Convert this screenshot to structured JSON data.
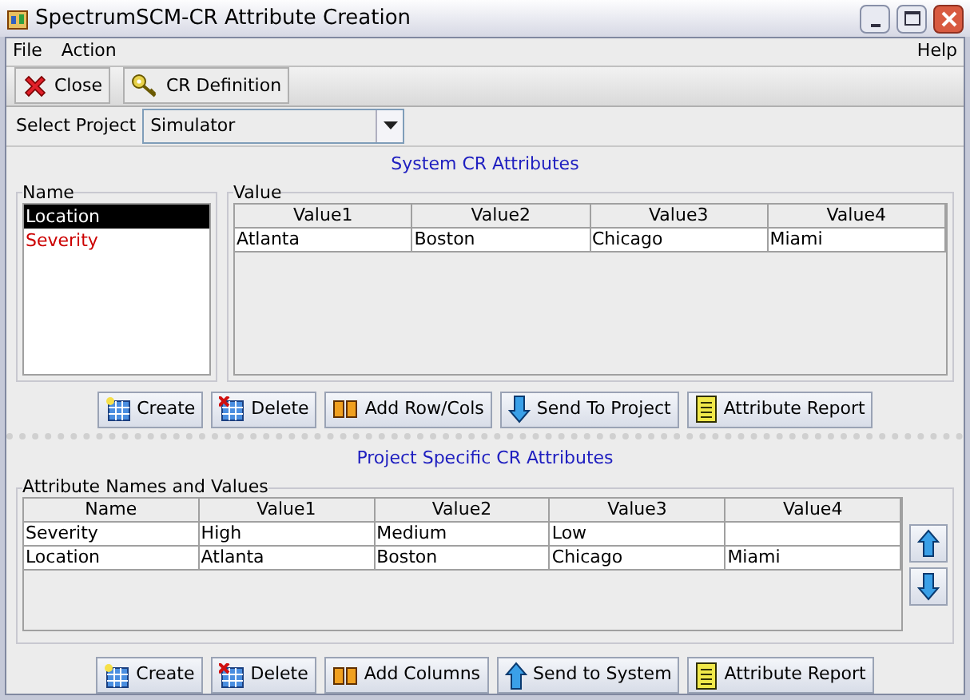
{
  "window": {
    "title": "SpectrumSCM-CR Attribute Creation"
  },
  "menu": {
    "left": [
      "File",
      "Action"
    ],
    "right": [
      "Help"
    ]
  },
  "toolbar": [
    {
      "label": "Close",
      "kind": "close"
    },
    {
      "label": "CR Definition",
      "kind": "key"
    }
  ],
  "project_select": {
    "label": "Select Project",
    "value": "Simulator"
  },
  "system_section": {
    "title": "System CR Attributes",
    "name_group": {
      "title": "Name",
      "items": [
        {
          "label": "Location",
          "selected": true
        },
        {
          "label": "Severity",
          "selected": false,
          "color": "#cc0000"
        }
      ]
    },
    "value_group": {
      "title": "Value",
      "columns": [
        "Value1",
        "Value2",
        "Value3",
        "Value4"
      ],
      "rows": [
        [
          "Atlanta",
          "Boston",
          "Chicago",
          "Miami"
        ]
      ]
    },
    "buttons": [
      {
        "label": "Create",
        "kind": "create"
      },
      {
        "label": "Delete",
        "kind": "delete"
      },
      {
        "label": "Add Row/Cols",
        "kind": "add"
      },
      {
        "label": "Send To Project",
        "kind": "down"
      },
      {
        "label": "Attribute Report",
        "kind": "report"
      }
    ]
  },
  "project_section": {
    "title": "Project Specific CR Attributes",
    "group_title": "Attribute Names and Values",
    "columns": [
      "Name",
      "Value1",
      "Value2",
      "Value3",
      "Value4"
    ],
    "rows": [
      [
        "Severity",
        "High",
        "Medium",
        "Low",
        ""
      ],
      [
        "Location",
        "Atlanta",
        "Boston",
        "Chicago",
        "Miami"
      ]
    ],
    "buttons": [
      {
        "label": "Create",
        "kind": "create"
      },
      {
        "label": "Delete",
        "kind": "delete"
      },
      {
        "label": "Add Columns",
        "kind": "add"
      },
      {
        "label": "Send to System",
        "kind": "up"
      },
      {
        "label": "Attribute Report",
        "kind": "report"
      }
    ]
  }
}
